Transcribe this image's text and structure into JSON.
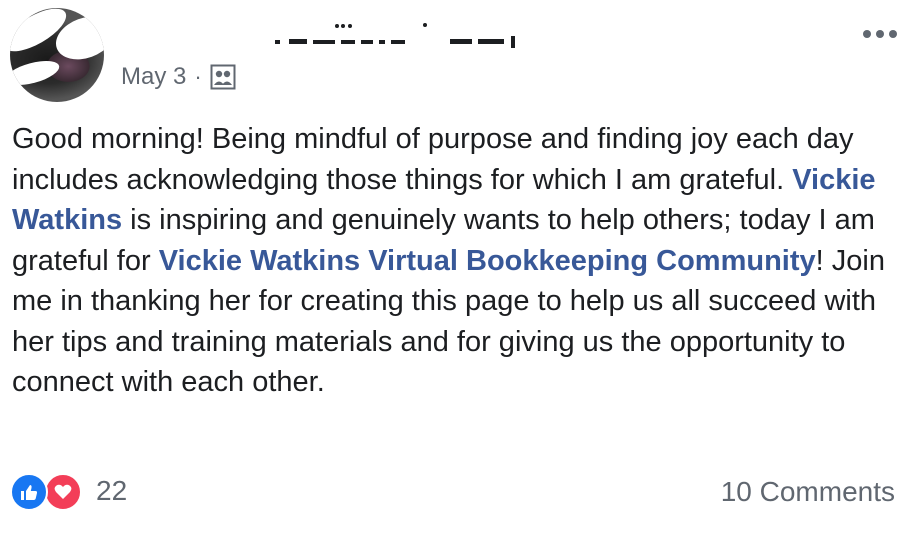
{
  "post": {
    "date": "May 3",
    "separator": "·",
    "audience_icon": "group-icon",
    "author_icon": "redacted-name"
  },
  "body": {
    "part1": "Good morning! Being mindful of purpose and finding joy each day includes acknowledging those things for which I am grateful.  ",
    "link1": "Vickie Watkins",
    "part2": " is inspiring and genuinely wants to help others;  today I am grateful for ",
    "link2": "Vickie Watkins Virtual Bookkeeping Community",
    "part3": "! Join me in thanking her for creating this page to help us all succeed with her tips and training materials and for giving us the opportunity to connect with each other."
  },
  "footer": {
    "reaction_count": "22",
    "comments_label": "10 Comments"
  },
  "colors": {
    "link": "#385898",
    "like": "#1877f2",
    "love": "#f33e58",
    "meta": "#606770"
  }
}
